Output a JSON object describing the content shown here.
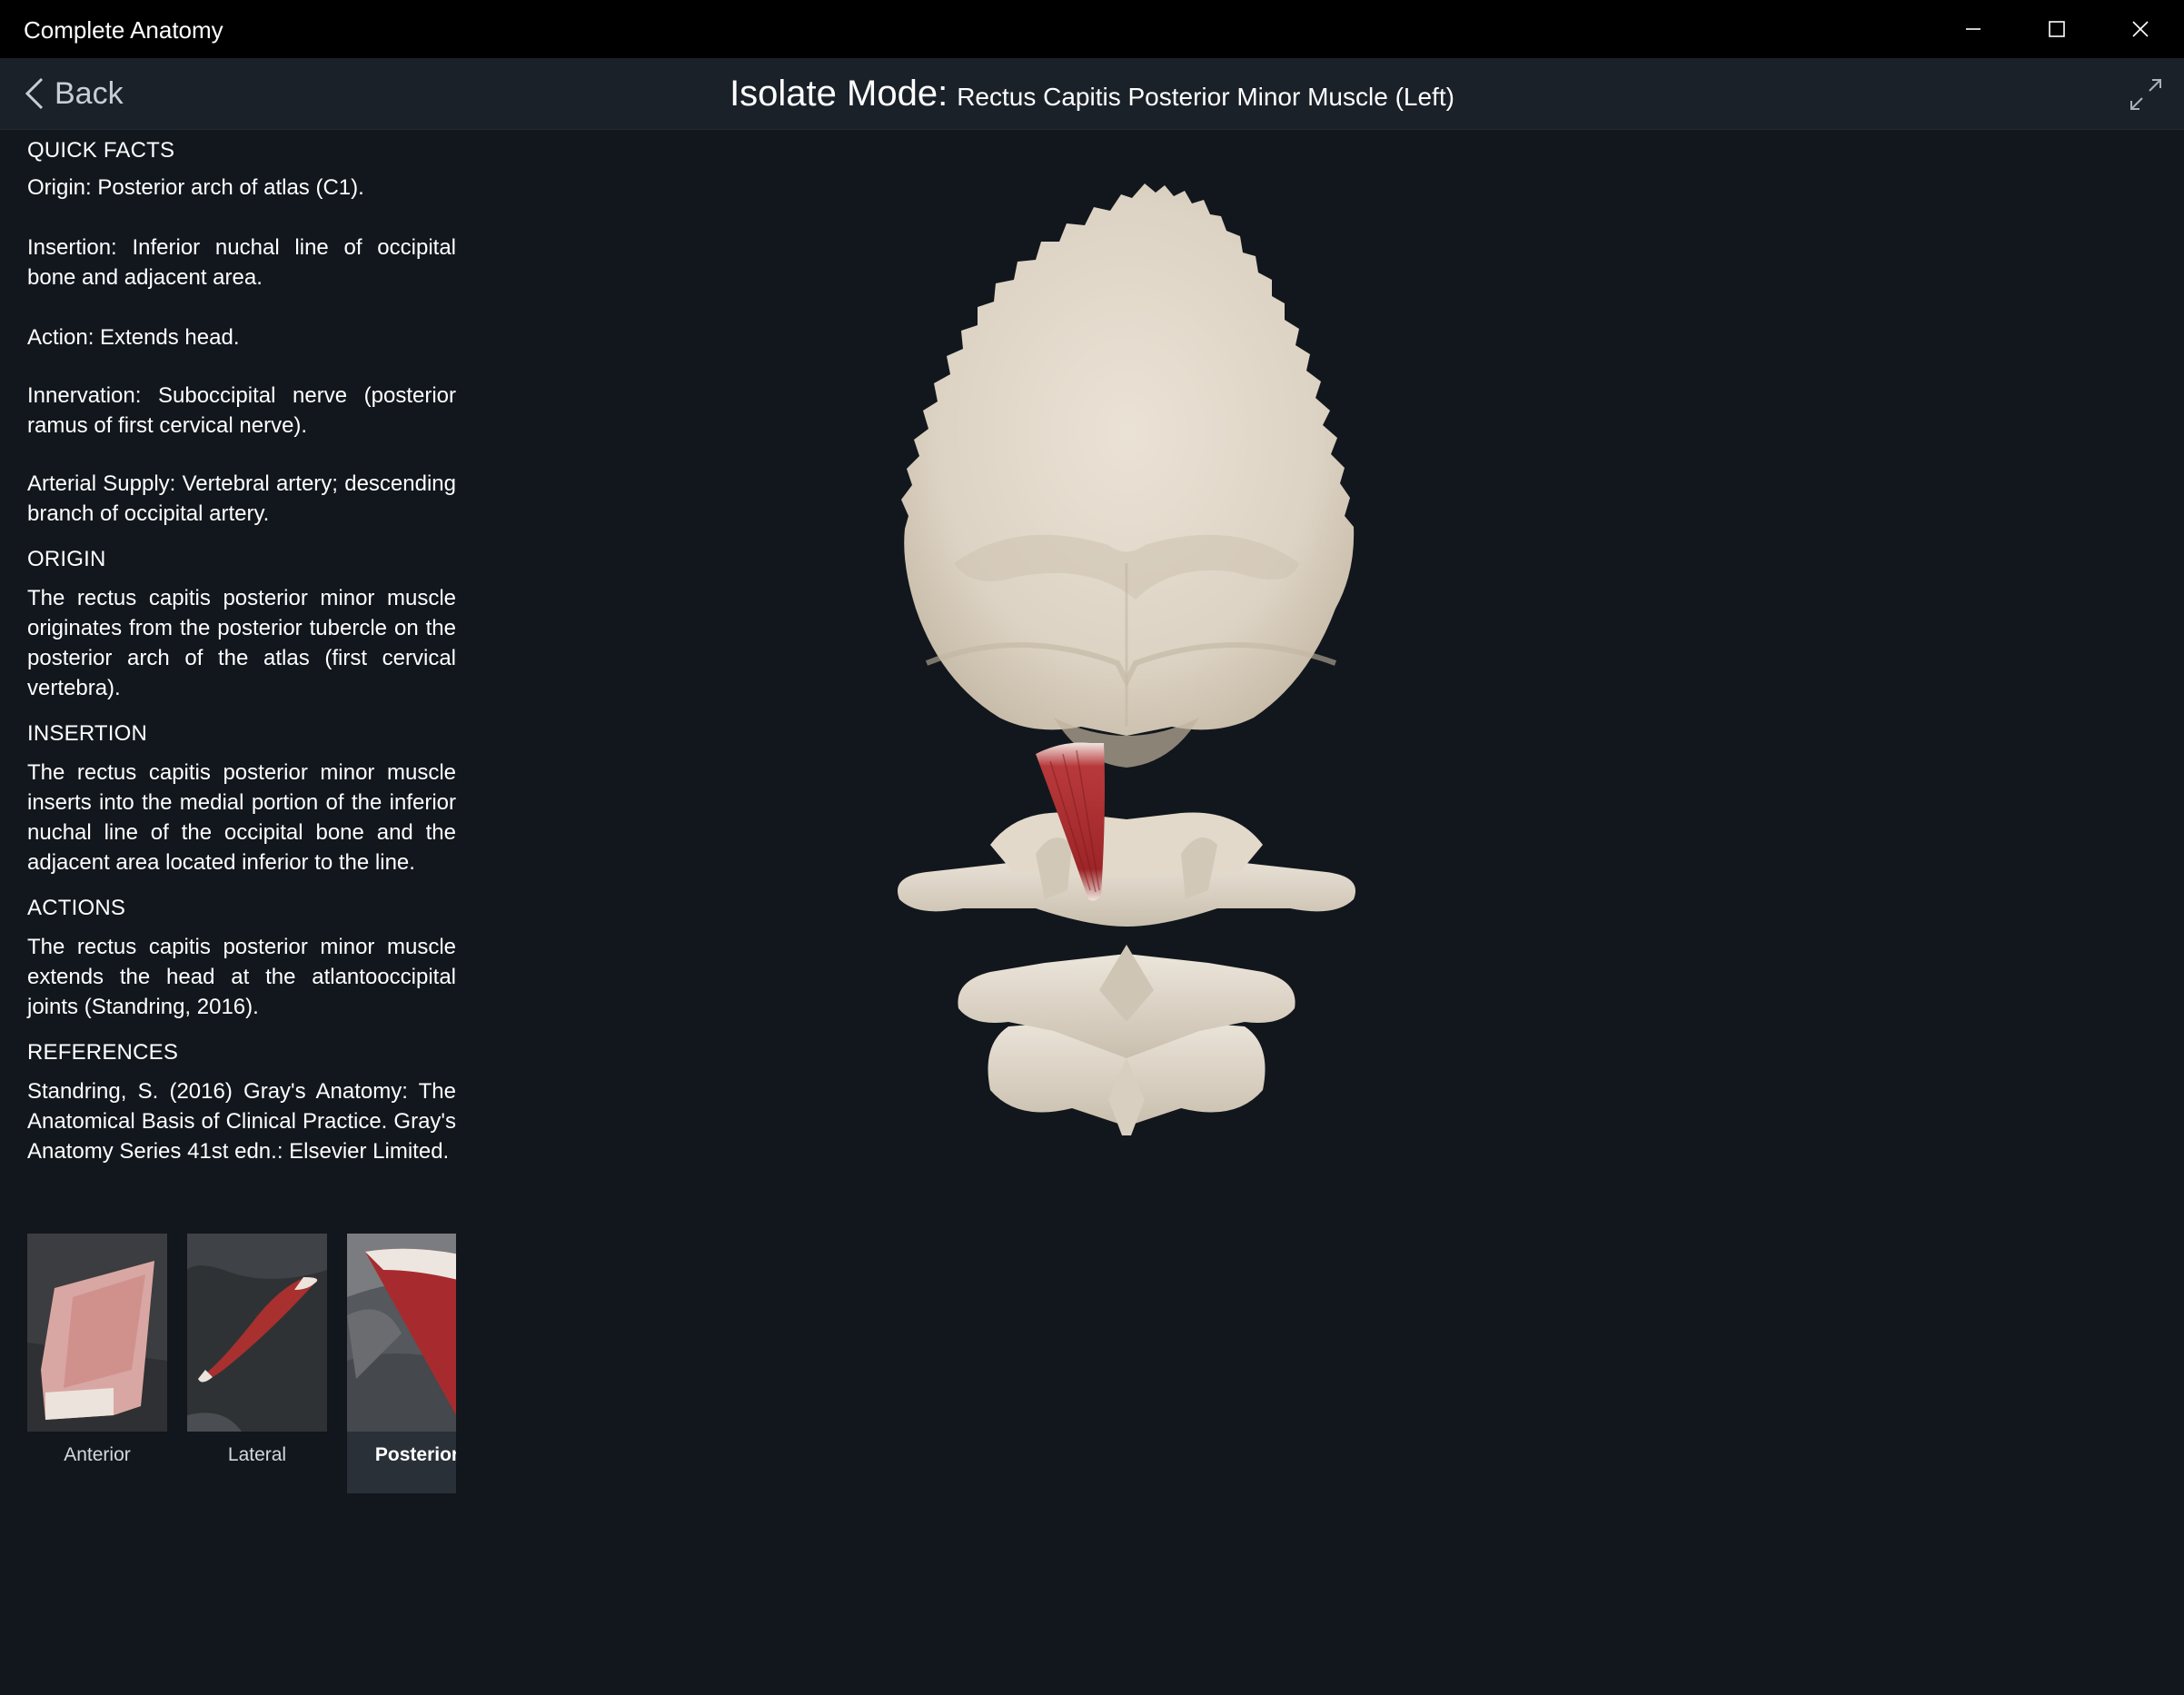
{
  "app": {
    "title": "Complete Anatomy"
  },
  "window_controls": {
    "minimize_icon": "minimize-icon",
    "maximize_icon": "maximize-icon",
    "close_icon": "close-icon"
  },
  "header": {
    "back_label": "Back",
    "mode_label": "Isolate Mode:",
    "subject": "Rectus Capitis Posterior Minor Muscle (Left)",
    "expand_icon": "expand-icon"
  },
  "panel": {
    "quick_facts": {
      "heading": "QUICK FACTS",
      "origin": "Origin: Posterior arch of atlas (C1).",
      "insertion": "Insertion: Inferior nuchal line of occipital bone and adjacent area.",
      "action": "Action: Extends head.",
      "innervation": "Innervation: Suboccipital nerve (posterior ramus of first cervical nerve).",
      "arterial_supply": "Arterial Supply: Vertebral artery; descending branch of occipital artery."
    },
    "origin": {
      "heading": "ORIGIN",
      "text": "The rectus capitis posterior minor muscle originates from the posterior tubercle on the posterior arch of the atlas (first cervical vertebra)."
    },
    "insertion": {
      "heading": "INSERTION",
      "text": "The rectus capitis posterior minor muscle inserts into the medial portion of the inferior nuchal line of the occipital bone and the adjacent area located inferior to the line."
    },
    "actions": {
      "heading": "ACTIONS",
      "text": "The rectus capitis posterior minor muscle extends the head at the atlantooccipital joints (Standring, 2016)."
    },
    "references": {
      "heading": "REFERENCES",
      "text": "Standring, S. (2016) Gray's Anatomy: The Anatomical Basis of Clinical Practice. Gray's Anatomy Series 41st edn.: Elsevier Limited."
    }
  },
  "views": [
    {
      "label": "Anterior",
      "selected": false
    },
    {
      "label": "Lateral",
      "selected": false
    },
    {
      "label": "Posterior",
      "selected": true
    }
  ],
  "colors": {
    "background": "#12171d",
    "titlebar": "#000000",
    "header": "#1b2129",
    "bone": "#e6ddd0",
    "muscle": "#a6262b"
  }
}
